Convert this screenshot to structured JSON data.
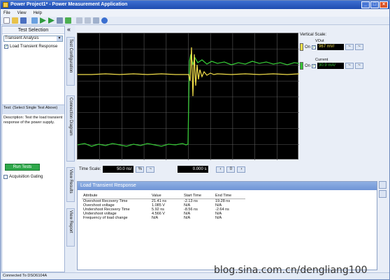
{
  "window": {
    "title": "Power Project1* - Power Measurement Application"
  },
  "menu": [
    "File",
    "View",
    "Help"
  ],
  "toolbar_icons": [
    "new-icon",
    "open-icon",
    "save-icon",
    "connect-icon",
    "run-icon",
    "next-icon",
    "list-icon",
    "report-icon",
    "undo-icon",
    "redo-icon",
    "wand-icon",
    "help-icon"
  ],
  "left_panel": {
    "title": "Test Selection",
    "analysis_select": "Transient Analysis",
    "test_item": "Load Transient Response",
    "test_header": "Test: (Select Single Test Above)",
    "description": "Description: Test the load transient response of the power supply.",
    "run_button": "Run Tests",
    "acq_gating": "Acquisition Gating"
  },
  "side_tabs": [
    "Test Configuration",
    "Connection Diagram",
    "View Results",
    "View Report"
  ],
  "vertical_scale": {
    "title": "Vertical Scale:",
    "channels": [
      {
        "name": "VOut",
        "on_label": "On",
        "value": "967 mV/",
        "color": "#f4e04a"
      },
      {
        "name": "Current",
        "on_label": "On",
        "value": "30.9 mA/",
        "color": "#35c535"
      }
    ]
  },
  "time_controls": {
    "label": "Time Scale:",
    "value": "50.0 ns/",
    "offset": "0.000 s",
    "center": "0"
  },
  "results": {
    "title": "Load Transient Response",
    "columns": [
      "Attribute",
      "Value",
      "Start Time",
      "End Time"
    ],
    "rows": [
      [
        "Overshoot Recovery Time",
        "21.41 ns",
        "-2.13 ns",
        "19.28 ns"
      ],
      [
        "Overshoot voltage",
        "1.085 V",
        "N/A",
        "N/A"
      ],
      [
        "Undershoot Recovery Time",
        "5.92 ns",
        "-8.56 ns",
        "-2.64 ns"
      ],
      [
        "Undershoot voltage",
        "4.566 V",
        "N/A",
        "N/A"
      ],
      [
        "Frequency of load change",
        "N/A",
        "N/A",
        "N/A"
      ]
    ]
  },
  "status": "Connected To DSO6104A",
  "watermark": "blog.sina.com.cn/dengliang100"
}
